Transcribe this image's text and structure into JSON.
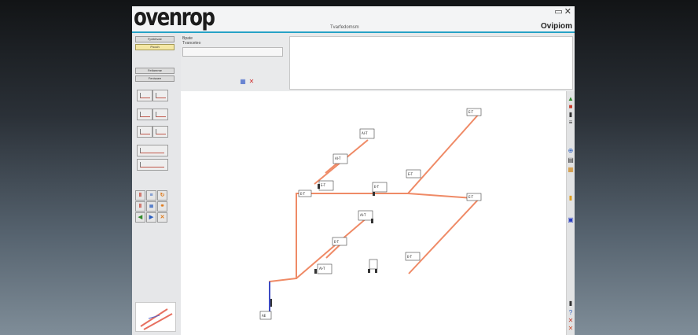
{
  "app": {
    "logo": "ovenrop",
    "document_title": "Tvarfedomsm",
    "name": "Ovipiom",
    "window_controls": [
      "▭",
      "✕"
    ]
  },
  "left_panel": {
    "buttons": [
      "Fpebbvae",
      "Pooch",
      "Fetheeme",
      "Fenisaee"
    ],
    "selected_index": 1
  },
  "properties": {
    "label": "Bpate",
    "value": "Tvanceteo"
  },
  "diagram": {
    "nodes": [
      {
        "id": "n1",
        "label": "E-T"
      },
      {
        "id": "n2",
        "label": "AI-T"
      },
      {
        "id": "n3",
        "label": "AI-T"
      },
      {
        "id": "n4",
        "label": "E-T"
      },
      {
        "id": "n5",
        "label": "E-T"
      },
      {
        "id": "n6",
        "label": "E-T"
      },
      {
        "id": "n7",
        "label": "E-T"
      },
      {
        "id": "n8",
        "label": "E-T"
      },
      {
        "id": "n9",
        "label": "AI-T"
      },
      {
        "id": "n10",
        "label": "E-T"
      },
      {
        "id": "n11",
        "label": "E-T"
      },
      {
        "id": "n12",
        "label": "AI-T"
      },
      {
        "id": "n13",
        "label": "AE"
      }
    ]
  },
  "colors": {
    "accent": "#27a2c6",
    "pipe": "#ef8a66",
    "riser": "#3d4bc4",
    "canvas": "#ffffff",
    "panel": "#e6e7e9"
  },
  "icons": {
    "tools": [
      "pipe-tool-icon",
      "elbow-tool-icon",
      "tee-tool-icon",
      "valve-tool-icon",
      "radiator-tool-icon"
    ],
    "right_strip": [
      "arrow-up-icon",
      "lock-icon",
      "pin-icon",
      "sort-icon",
      "zoom-icon",
      "folder-icon",
      "grid-icon",
      "key-icon",
      "info-icon",
      "close-icon"
    ]
  }
}
